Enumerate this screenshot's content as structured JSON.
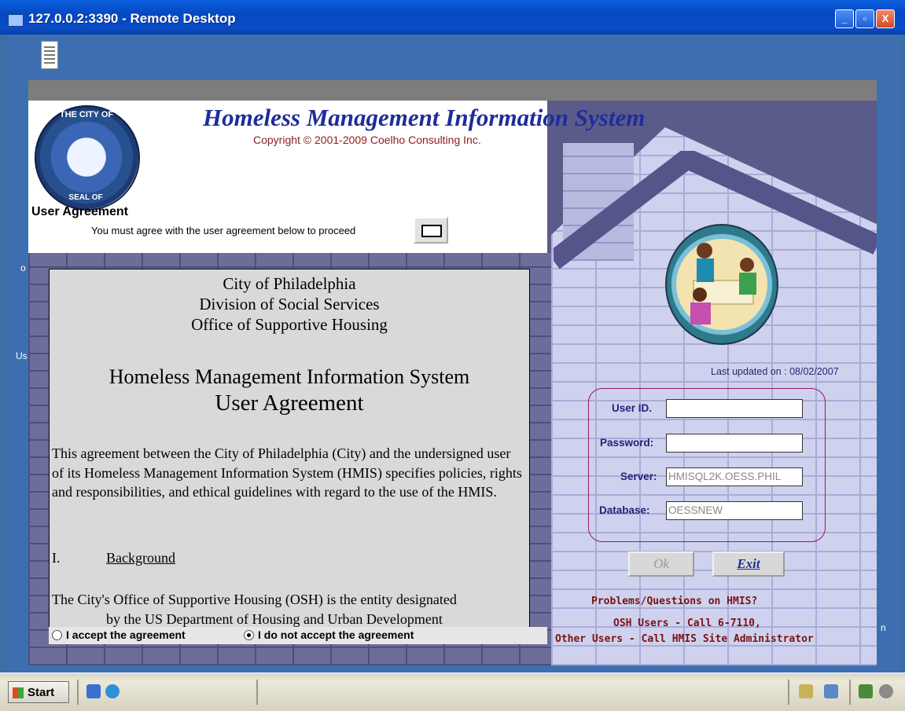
{
  "window": {
    "title": "127.0.0.2:3390 - Remote Desktop",
    "controls": {
      "minimize": "_",
      "maximize": "▫",
      "close": "X"
    }
  },
  "desktop": {
    "side_chars": [
      "o",
      "Us",
      "n"
    ]
  },
  "app": {
    "title": "Homeless Management Information System",
    "copyright": "Copyright © 2001-2009 Coelho Consulting Inc.",
    "seal": {
      "top_text": "THE CITY OF",
      "bottom_text": "SEAL OF"
    },
    "user_agreement_heading": "User Agreement",
    "instruction": "You must agree with the user agreement below to proceed"
  },
  "agreement": {
    "line1": "City of Philadelphia",
    "line2": "Division of Social Services",
    "line3": "Office of Supportive Housing",
    "line4": "Homeless Management Information System",
    "line5": "User Agreement",
    "paragraph1": "This agreement between the City of Philadelphia (City) and the undersigned user of its Homeless Management Information System (HMIS) specifies policies, rights and responsibilities, and ethical guidelines with regard to the use of the HMIS.",
    "section_number": "I.",
    "section_title": "Background",
    "paragraph2_line1": "The City's Office of Supportive Housing (OSH) is the entity designated",
    "paragraph2_line2": "by the US Department of Housing and Urban Development",
    "scroll_up": "▲",
    "scroll_down": "▼"
  },
  "radios": {
    "accept": "I accept the agreement",
    "decline": "I do not accept the agreement",
    "selected": "decline"
  },
  "login": {
    "last_updated": "Last updated on : 08/02/2007",
    "user_id_label": "User ID.",
    "user_id_value": "",
    "password_label": "Password:",
    "password_value": "",
    "server_label": "Server:",
    "server_value": "HMISQL2K.OESS.PHIL",
    "database_label": "Database:",
    "database_value": "OESSNEW",
    "ok_label": "Ok",
    "exit_label": "Exit"
  },
  "help": {
    "line1": "Problems/Questions on HMIS?",
    "line2": "OSH Users  - Call 6-7110,",
    "line3": "Other Users - Call HMIS Site Administrator"
  },
  "taskbar": {
    "start_label": "Start"
  },
  "colors": {
    "title_blue": "#1f2c9b",
    "help_red": "#7a1212",
    "login_border": "#8e1a63",
    "titlebar": "#0548c2"
  }
}
